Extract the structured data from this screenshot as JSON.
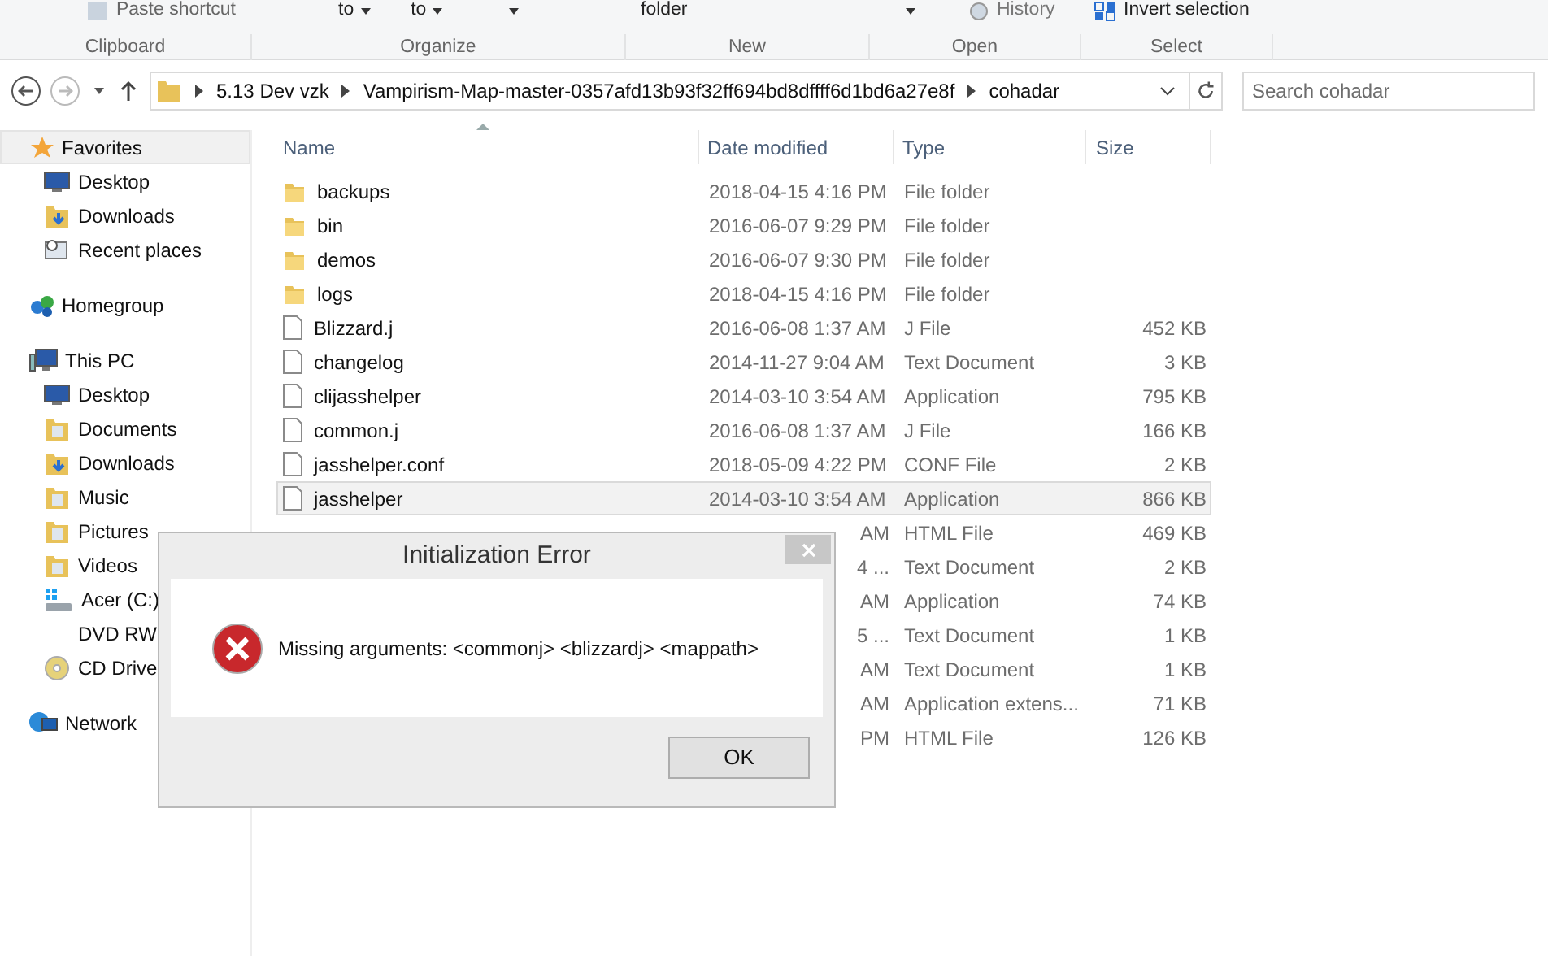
{
  "ribbon": {
    "items": [
      {
        "label": "Paste shortcut",
        "kind": "paste"
      },
      {
        "label": "to",
        "kind": "drop"
      },
      {
        "label": "to",
        "kind": "drop"
      },
      {
        "kind": "caret"
      },
      {
        "label": "folder",
        "kind": "text"
      },
      {
        "kind": "caret"
      },
      {
        "label": "History",
        "kind": "history"
      },
      {
        "label": "Invert selection",
        "kind": "invert"
      }
    ],
    "groups": [
      {
        "label": "Clipboard"
      },
      {
        "label": "Organize"
      },
      {
        "label": "New"
      },
      {
        "label": "Open"
      },
      {
        "label": "Select"
      }
    ]
  },
  "address": {
    "crumbs": [
      "5.13 Dev vzk",
      "Vampirism-Map-master-0357afd13b93f32ff694bd8dffff6d1bd6a27e8f",
      "cohadar"
    ],
    "search_placeholder": "Search cohadar"
  },
  "sidebar": [
    {
      "label": "Favorites",
      "kind": "star",
      "selected": true,
      "children": [
        {
          "label": "Desktop",
          "kind": "desktop"
        },
        {
          "label": "Downloads",
          "kind": "downloads"
        },
        {
          "label": "Recent places",
          "kind": "recent"
        }
      ]
    },
    {
      "label": "Homegroup",
      "kind": "homegroup",
      "selected": false
    },
    {
      "label": "This PC",
      "kind": "pc",
      "selected": false,
      "children": [
        {
          "label": "Desktop",
          "kind": "desktop"
        },
        {
          "label": "Documents",
          "kind": "folder"
        },
        {
          "label": "Downloads",
          "kind": "downloads"
        },
        {
          "label": "Music",
          "kind": "folder"
        },
        {
          "label": "Pictures",
          "kind": "folder"
        },
        {
          "label": "Videos",
          "kind": "folder"
        },
        {
          "label": "Acer (C:)",
          "kind": "drive"
        },
        {
          "label": "DVD RW",
          "kind": "none"
        },
        {
          "label": "CD Drive",
          "kind": "cd"
        }
      ]
    },
    {
      "label": "Network",
      "kind": "network",
      "selected": false
    }
  ],
  "columns": [
    "Name",
    "Date modified",
    "Type",
    "Size"
  ],
  "files": [
    {
      "name": "backups",
      "date": "2018-04-15 4:16 PM",
      "type": "File folder",
      "kind": "folder",
      "selected": false
    },
    {
      "name": "bin",
      "date": "2016-06-07 9:29 PM",
      "type": "File folder",
      "kind": "folder",
      "selected": false
    },
    {
      "name": "demos",
      "date": "2016-06-07 9:30 PM",
      "type": "File folder",
      "kind": "folder",
      "selected": false
    },
    {
      "name": "logs",
      "date": "2018-04-15 4:16 PM",
      "type": "File folder",
      "kind": "folder",
      "selected": false
    },
    {
      "name": "Blizzard.j",
      "date": "2016-06-08 1:37 AM",
      "type": "J File",
      "size": "452 KB",
      "kind": "file",
      "selected": false
    },
    {
      "name": "changelog",
      "date": "2014-11-27 9:04 AM",
      "type": "Text Document",
      "size": "3 KB",
      "kind": "file",
      "selected": false
    },
    {
      "name": "clijasshelper",
      "date": "2014-03-10 3:54 AM",
      "type": "Application",
      "size": "795 KB",
      "kind": "file",
      "selected": false
    },
    {
      "name": "common.j",
      "date": "2016-06-08 1:37 AM",
      "type": "J File",
      "size": "166 KB",
      "kind": "file",
      "selected": false
    },
    {
      "name": "jasshelper.conf",
      "date": "2018-05-09 4:22 PM",
      "type": "CONF File",
      "size": "2 KB",
      "kind": "file",
      "selected": false
    },
    {
      "name": "jasshelper",
      "date": "2014-03-10 3:54 AM",
      "type": "Application",
      "size": "866 KB",
      "kind": "file",
      "selected": true
    },
    {
      "date": "AM",
      "type": "HTML File",
      "size": "469 KB",
      "kind": "hidden",
      "selected": false
    },
    {
      "date": "4 ...",
      "type": "Text Document",
      "size": "2 KB",
      "kind": "hidden",
      "selected": false
    },
    {
      "date": "AM",
      "type": "Application",
      "size": "74 KB",
      "kind": "hidden",
      "selected": false
    },
    {
      "date": "5 ...",
      "type": "Text Document",
      "size": "1 KB",
      "kind": "hidden",
      "selected": false
    },
    {
      "date": "AM",
      "type": "Text Document",
      "size": "1 KB",
      "kind": "hidden",
      "selected": false
    },
    {
      "date": "AM",
      "type": "Application extens...",
      "size": "71 KB",
      "kind": "hidden",
      "selected": false
    },
    {
      "date": "PM",
      "type": "HTML File",
      "size": "126 KB",
      "kind": "hidden",
      "selected": false
    }
  ],
  "dialog": {
    "title": "Initialization Error",
    "message": "Missing arguments: <commonj> <blizzardj> <mappath>",
    "button": "OK"
  }
}
